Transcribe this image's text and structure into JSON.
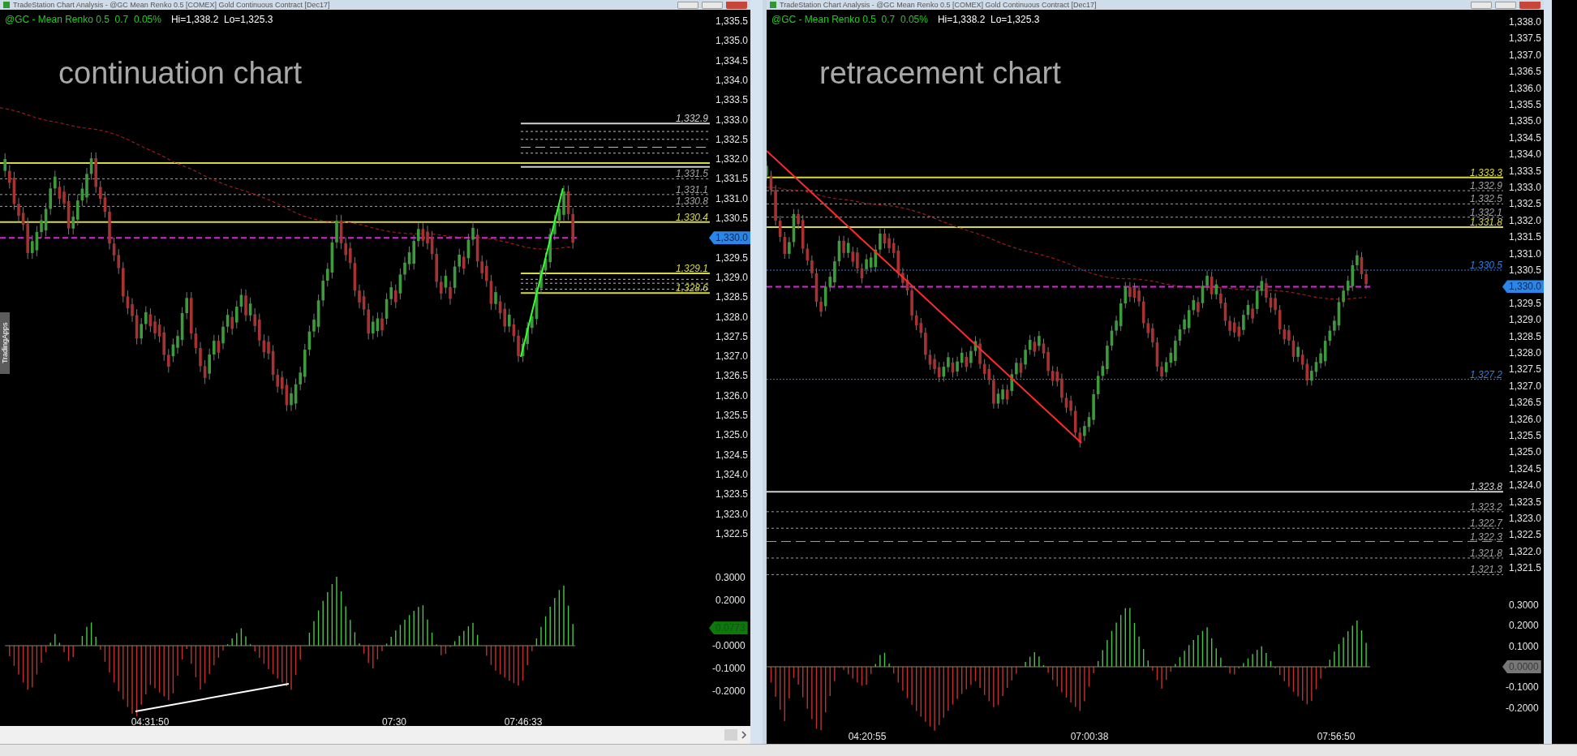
{
  "side_tab": "TradingApps",
  "windows": [
    {
      "title": "TradeStation Chart Analysis - @GC Mean Renko 0.5 [COMEX] Gold Continuous Contract [Dec17]",
      "symbol_info": "@GC - Mean Renko 0.5  0.7  0.05%",
      "range_info": "Hi=1,338.2  Lo=1,325.3",
      "chart_label": "continuation chart",
      "price_axis": [
        "1,335.5",
        "1,335.0",
        "1,334.5",
        "1,334.0",
        "1,333.5",
        "1,333.0",
        "1,332.5",
        "1,332.0",
        "1,331.5",
        "1,331.0",
        "1,330.5",
        "1,329.5",
        "1,329.0",
        "1,328.5",
        "1,328.0",
        "1,327.5",
        "1,327.0",
        "1,326.5",
        "1,326.0",
        "1,325.5",
        "1,325.0",
        "1,324.5",
        "1,324.0",
        "1,323.5",
        "1,323.0",
        "1,322.5"
      ],
      "levels": [
        {
          "label": "1,332.9",
          "kind": "solid",
          "color": "#d0d0d0"
        },
        {
          "label": "1,331.5",
          "kind": "dashed",
          "color": "#a0a0a0"
        },
        {
          "label": "1,331.1",
          "kind": "dashed",
          "color": "#a0a0a0"
        },
        {
          "label": "1,330.8",
          "kind": "dashed",
          "color": "#a0a0a0"
        },
        {
          "label": "1,330.4",
          "kind": "solid",
          "color": "#d8d840"
        },
        {
          "label": "1,329.1",
          "kind": "solid",
          "color": "#d8d840"
        },
        {
          "label": "1,328.6",
          "kind": "solid",
          "color": "#d8d840"
        }
      ],
      "price_badge": "1,330.0",
      "indicator_axis": [
        "0.3000",
        "0.2000",
        "-0.0000",
        "-0.1000",
        "-0.2000"
      ],
      "indicator_badge": "0.0773",
      "time_axis": [
        "04:31:50",
        "07:30",
        "07:46:33"
      ]
    },
    {
      "title": "TradeStation Chart Analysis - @GC Mean Renko 0.5 [COMEX] Gold Continuous Contract [Dec17]",
      "symbol_info": "@GC - Mean Renko 0.5  0.7  0.05%",
      "range_info": "Hi=1,338.2  Lo=1,325.3",
      "chart_label": "retracement chart",
      "price_axis": [
        "1,338.0",
        "1,337.5",
        "1,337.0",
        "1,336.5",
        "1,336.0",
        "1,335.5",
        "1,335.0",
        "1,334.5",
        "1,334.0",
        "1,333.5",
        "1,333.0",
        "1,332.5",
        "1,332.0",
        "1,331.5",
        "1,331.0",
        "1,330.5",
        "1,329.5",
        "1,329.0",
        "1,328.5",
        "1,328.0",
        "1,327.5",
        "1,327.0",
        "1,326.5",
        "1,326.0",
        "1,325.5",
        "1,325.0",
        "1,324.5",
        "1,324.0",
        "1,323.5",
        "1,323.0",
        "1,322.5",
        "1,322.0",
        "1,321.5"
      ],
      "levels": [
        {
          "label": "1,333.3",
          "kind": "solid",
          "color": "#d8d840"
        },
        {
          "label": "1,332.9",
          "kind": "dashed",
          "color": "#a0a0a0"
        },
        {
          "label": "1,332.5",
          "kind": "dashed",
          "color": "#a0a0a0"
        },
        {
          "label": "1,332.1",
          "kind": "dashed",
          "color": "#a0a0a0"
        },
        {
          "label": "1,331.8",
          "kind": "solid",
          "color": "#d8d840"
        },
        {
          "label": "1,330.5",
          "kind": "dotted",
          "color": "#2f7fe0"
        },
        {
          "label": "1,327.2",
          "kind": "dotted",
          "color": "#2f7fe0"
        },
        {
          "label": "1,323.8",
          "kind": "solid",
          "color": "#d0d0d0"
        },
        {
          "label": "1,323.2",
          "kind": "dashed",
          "color": "#a0a0a0"
        },
        {
          "label": "1,322.7",
          "kind": "dashed",
          "color": "#a0a0a0"
        },
        {
          "label": "1,322.3",
          "kind": "long-dash",
          "color": "#a0a0a0"
        },
        {
          "label": "1,321.8",
          "kind": "dashed",
          "color": "#a0a0a0"
        },
        {
          "label": "1,321.3",
          "kind": "dashed",
          "color": "#a0a0a0"
        }
      ],
      "price_badge": "1,330.0",
      "indicator_axis": [
        "0.3000",
        "0.2000",
        "0.1000",
        "-0.1000",
        "-0.2000"
      ],
      "indicator_badge": "0.0000",
      "time_axis": [
        "04:20:55",
        "07:00:38",
        "07:56:50"
      ]
    }
  ]
}
